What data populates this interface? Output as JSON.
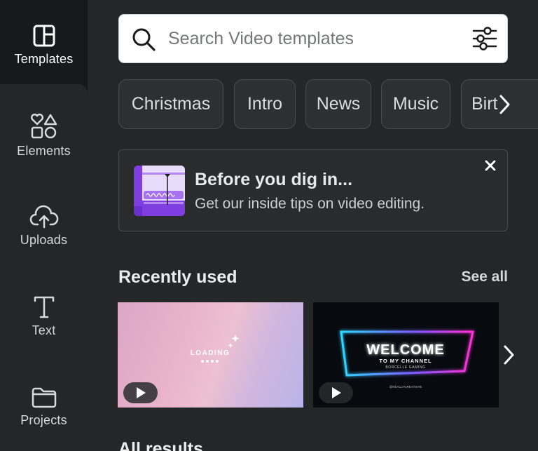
{
  "sidebar": {
    "items": [
      {
        "label": "Templates",
        "icon": "layout-icon"
      },
      {
        "label": "Elements",
        "icon": "shapes-icon"
      },
      {
        "label": "Uploads",
        "icon": "cloud-upload-icon"
      },
      {
        "label": "Text",
        "icon": "text-t-icon"
      },
      {
        "label": "Projects",
        "icon": "folder-icon"
      }
    ],
    "active": "Templates"
  },
  "search": {
    "placeholder": "Search Video templates",
    "value": ""
  },
  "chips": [
    "Christmas",
    "Intro",
    "News",
    "Music",
    "Birt"
  ],
  "tip": {
    "title": "Before you dig in...",
    "subtitle": "Get our inside tips on video editing."
  },
  "recent": {
    "title": "Recently used",
    "see_all": "See all",
    "cards": [
      {
        "text": "LOADING",
        "theme": "pastel-gradient"
      },
      {
        "title": "WELCOME",
        "subtitle": "TO MY CHANNEL",
        "small": "BORCELLE GAMING",
        "handle": "@REALLYGREATSITE",
        "theme": "neon"
      }
    ]
  },
  "all_results": "All results",
  "colors": {
    "background": "#18191b",
    "panel": "#252627",
    "tip_purple": "#7f3fe0"
  }
}
